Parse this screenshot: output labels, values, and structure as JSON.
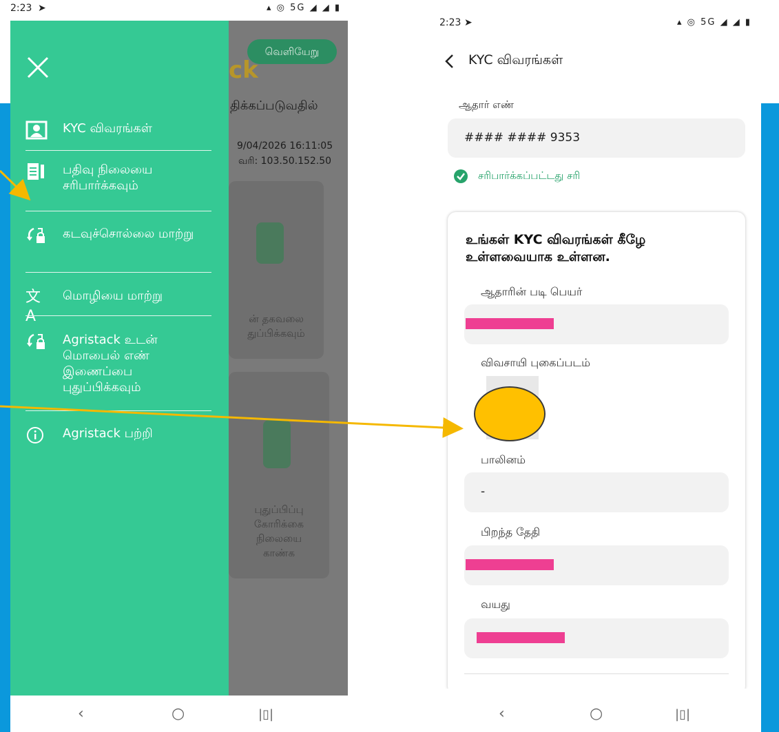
{
  "left_phone": {
    "status_time": "2:23",
    "background_app": {
      "exit_button": "வெளியேறு",
      "logo_fragment": "ck",
      "heading_fragment": "திக்கப்படுவதில்",
      "date_fragment": "9/04/2026 16:11:05",
      "ip_fragment": "வரி: 103.50.152.50",
      "card1_text": [
        "ன் தகவலை",
        "துப்பிக்கவும்"
      ],
      "card2_text": [
        "புதுப்பிப்பு",
        "கோரிக்கை",
        "நிலையை",
        "காண்க"
      ]
    },
    "drawer": {
      "close_icon": "close-icon",
      "items": [
        {
          "label": "KYC விவரங்கள்",
          "icon": "id-card-icon"
        },
        {
          "label": "பதிவு நிலையை சரிபார்க்கவும்",
          "icon": "clipboard-icon"
        },
        {
          "label": "கடவுச்சொல்லை மாற்று",
          "icon": "lock-refresh-icon"
        },
        {
          "label": "மொழியை மாற்று",
          "icon": "translate-icon"
        },
        {
          "label": "Agristack உடன் மொபைல் எண் இணைப்பை புதுப்பிக்கவும்",
          "icon": "lock-refresh-icon"
        },
        {
          "label": "Agristack பற்றி",
          "icon": "info-icon"
        }
      ]
    }
  },
  "right_phone": {
    "status_time": "2:23",
    "title": "KYC விவரங்கள்",
    "aadhaar_label": "ஆதார் எண்",
    "aadhaar_value": "#### #### 9353",
    "verified_text": "சரிபார்க்கப்பட்டது சரி",
    "card": {
      "heading": "உங்கள் KYC விவரங்கள் கீழே உள்ளவையாக உள்ளன.",
      "fields": [
        {
          "label": "ஆதாரின் படி பெயர்",
          "value": ""
        },
        {
          "label": "விவசாயி புகைப்படம்",
          "value": ""
        },
        {
          "label": "பாலினம்",
          "value": "-"
        },
        {
          "label": "பிறந்த தேதி",
          "value": ""
        },
        {
          "label": "வயது",
          "value": ""
        }
      ]
    }
  },
  "colors": {
    "drawer": "#35c994",
    "background": "#0b98dc",
    "arrow": "#f5b800",
    "redaction": "#ee3f92",
    "verified": "#27a36b"
  }
}
